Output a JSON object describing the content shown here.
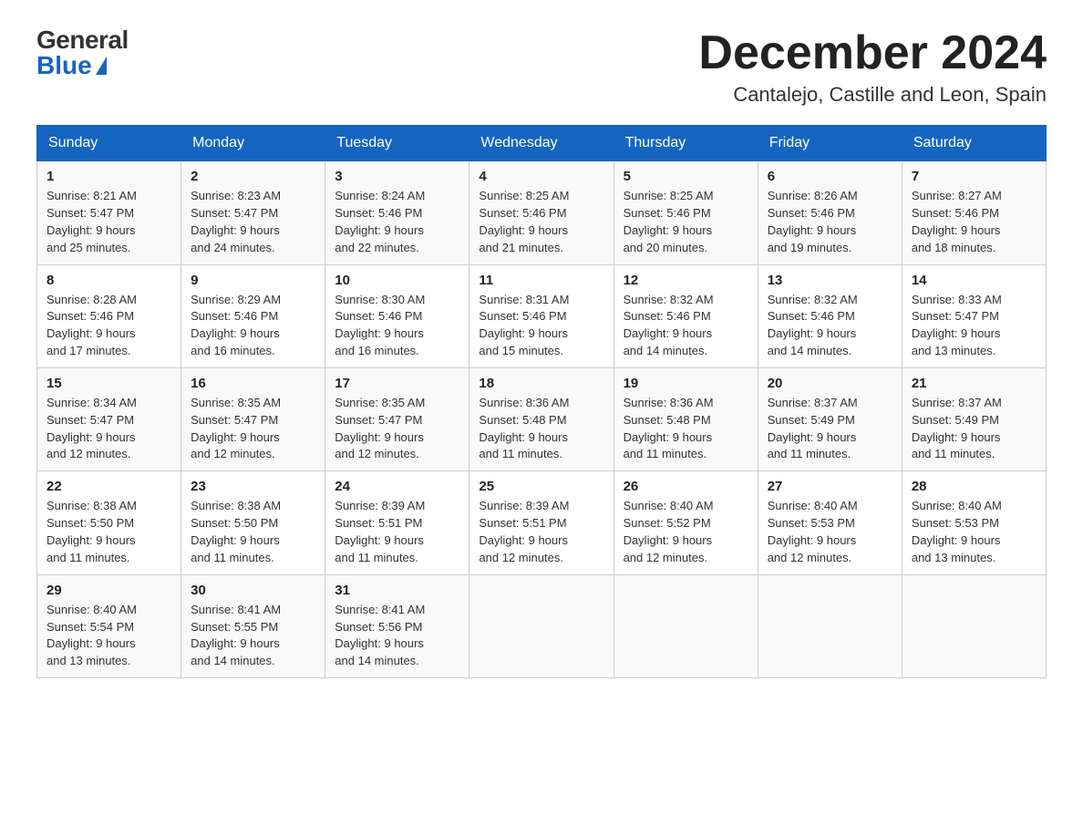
{
  "header": {
    "logo_general": "General",
    "logo_blue": "Blue",
    "month_title": "December 2024",
    "location": "Cantalejo, Castille and Leon, Spain"
  },
  "weekdays": [
    "Sunday",
    "Monday",
    "Tuesday",
    "Wednesday",
    "Thursday",
    "Friday",
    "Saturday"
  ],
  "weeks": [
    [
      {
        "day": "1",
        "sunrise": "8:21 AM",
        "sunset": "5:47 PM",
        "daylight": "9 hours and 25 minutes."
      },
      {
        "day": "2",
        "sunrise": "8:23 AM",
        "sunset": "5:47 PM",
        "daylight": "9 hours and 24 minutes."
      },
      {
        "day": "3",
        "sunrise": "8:24 AM",
        "sunset": "5:46 PM",
        "daylight": "9 hours and 22 minutes."
      },
      {
        "day": "4",
        "sunrise": "8:25 AM",
        "sunset": "5:46 PM",
        "daylight": "9 hours and 21 minutes."
      },
      {
        "day": "5",
        "sunrise": "8:25 AM",
        "sunset": "5:46 PM",
        "daylight": "9 hours and 20 minutes."
      },
      {
        "day": "6",
        "sunrise": "8:26 AM",
        "sunset": "5:46 PM",
        "daylight": "9 hours and 19 minutes."
      },
      {
        "day": "7",
        "sunrise": "8:27 AM",
        "sunset": "5:46 PM",
        "daylight": "9 hours and 18 minutes."
      }
    ],
    [
      {
        "day": "8",
        "sunrise": "8:28 AM",
        "sunset": "5:46 PM",
        "daylight": "9 hours and 17 minutes."
      },
      {
        "day": "9",
        "sunrise": "8:29 AM",
        "sunset": "5:46 PM",
        "daylight": "9 hours and 16 minutes."
      },
      {
        "day": "10",
        "sunrise": "8:30 AM",
        "sunset": "5:46 PM",
        "daylight": "9 hours and 16 minutes."
      },
      {
        "day": "11",
        "sunrise": "8:31 AM",
        "sunset": "5:46 PM",
        "daylight": "9 hours and 15 minutes."
      },
      {
        "day": "12",
        "sunrise": "8:32 AM",
        "sunset": "5:46 PM",
        "daylight": "9 hours and 14 minutes."
      },
      {
        "day": "13",
        "sunrise": "8:32 AM",
        "sunset": "5:46 PM",
        "daylight": "9 hours and 14 minutes."
      },
      {
        "day": "14",
        "sunrise": "8:33 AM",
        "sunset": "5:47 PM",
        "daylight": "9 hours and 13 minutes."
      }
    ],
    [
      {
        "day": "15",
        "sunrise": "8:34 AM",
        "sunset": "5:47 PM",
        "daylight": "9 hours and 12 minutes."
      },
      {
        "day": "16",
        "sunrise": "8:35 AM",
        "sunset": "5:47 PM",
        "daylight": "9 hours and 12 minutes."
      },
      {
        "day": "17",
        "sunrise": "8:35 AM",
        "sunset": "5:47 PM",
        "daylight": "9 hours and 12 minutes."
      },
      {
        "day": "18",
        "sunrise": "8:36 AM",
        "sunset": "5:48 PM",
        "daylight": "9 hours and 11 minutes."
      },
      {
        "day": "19",
        "sunrise": "8:36 AM",
        "sunset": "5:48 PM",
        "daylight": "9 hours and 11 minutes."
      },
      {
        "day": "20",
        "sunrise": "8:37 AM",
        "sunset": "5:49 PM",
        "daylight": "9 hours and 11 minutes."
      },
      {
        "day": "21",
        "sunrise": "8:37 AM",
        "sunset": "5:49 PM",
        "daylight": "9 hours and 11 minutes."
      }
    ],
    [
      {
        "day": "22",
        "sunrise": "8:38 AM",
        "sunset": "5:50 PM",
        "daylight": "9 hours and 11 minutes."
      },
      {
        "day": "23",
        "sunrise": "8:38 AM",
        "sunset": "5:50 PM",
        "daylight": "9 hours and 11 minutes."
      },
      {
        "day": "24",
        "sunrise": "8:39 AM",
        "sunset": "5:51 PM",
        "daylight": "9 hours and 11 minutes."
      },
      {
        "day": "25",
        "sunrise": "8:39 AM",
        "sunset": "5:51 PM",
        "daylight": "9 hours and 12 minutes."
      },
      {
        "day": "26",
        "sunrise": "8:40 AM",
        "sunset": "5:52 PM",
        "daylight": "9 hours and 12 minutes."
      },
      {
        "day": "27",
        "sunrise": "8:40 AM",
        "sunset": "5:53 PM",
        "daylight": "9 hours and 12 minutes."
      },
      {
        "day": "28",
        "sunrise": "8:40 AM",
        "sunset": "5:53 PM",
        "daylight": "9 hours and 13 minutes."
      }
    ],
    [
      {
        "day": "29",
        "sunrise": "8:40 AM",
        "sunset": "5:54 PM",
        "daylight": "9 hours and 13 minutes."
      },
      {
        "day": "30",
        "sunrise": "8:41 AM",
        "sunset": "5:55 PM",
        "daylight": "9 hours and 14 minutes."
      },
      {
        "day": "31",
        "sunrise": "8:41 AM",
        "sunset": "5:56 PM",
        "daylight": "9 hours and 14 minutes."
      },
      null,
      null,
      null,
      null
    ]
  ],
  "labels": {
    "sunrise": "Sunrise:",
    "sunset": "Sunset:",
    "daylight": "Daylight:"
  }
}
